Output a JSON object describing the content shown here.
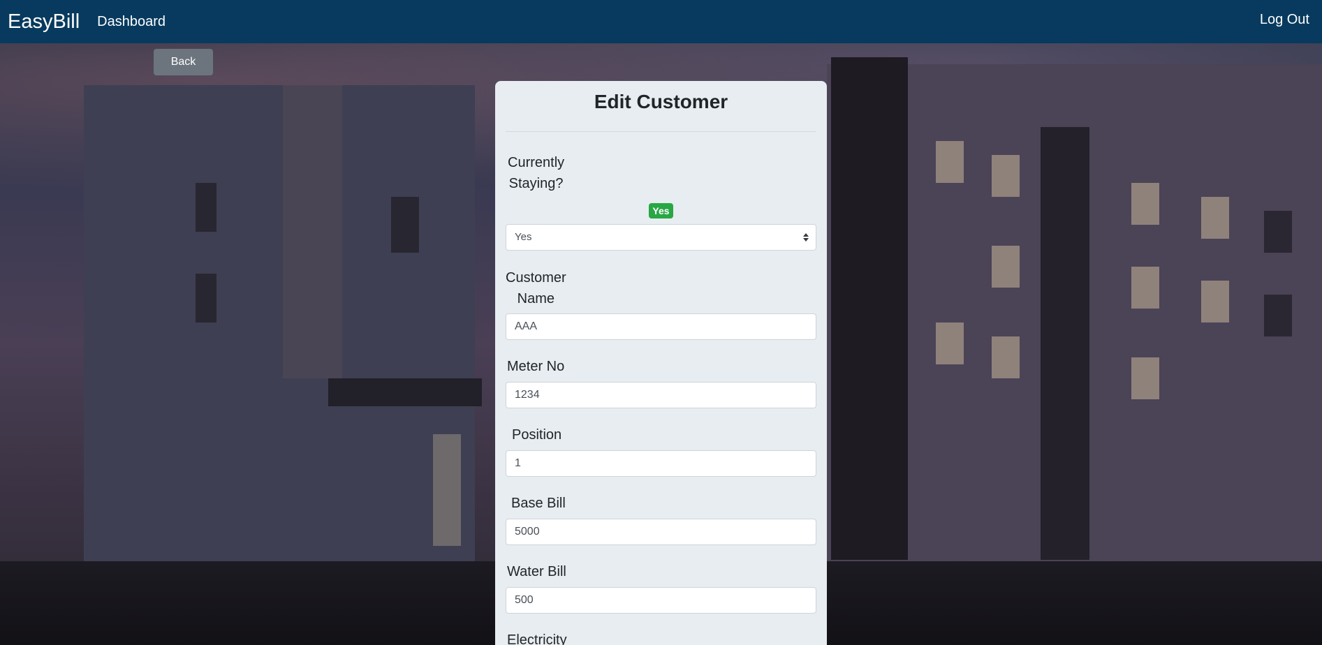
{
  "navbar": {
    "brand": "EasyBill",
    "dashboard_label": "Dashboard",
    "logout_label": "Log Out",
    "bg_color": "#073a5e"
  },
  "back_label": "Back",
  "form": {
    "title": "Edit Customer",
    "currently_staying": {
      "label_line1": "Currently",
      "label_line2": "Staying?",
      "badge": "Yes",
      "selected": "Yes"
    },
    "customer_name": {
      "label_line1": "Customer",
      "label_line2": "Name",
      "value": "AAA"
    },
    "meter_no": {
      "label": "Meter No",
      "value": "1234"
    },
    "position": {
      "label": "Position",
      "value": "1"
    },
    "base_bill": {
      "label": "Base Bill",
      "value": "5000"
    },
    "water_bill": {
      "label": "Water Bill",
      "value": "500"
    },
    "electricity": {
      "label": "Electricity"
    }
  },
  "colors": {
    "badge_green": "#28a745",
    "back_button": "#6c757d",
    "card_bg": "#e7edf0"
  },
  "icons": {
    "select_arrow": "select-arrow-icon"
  }
}
